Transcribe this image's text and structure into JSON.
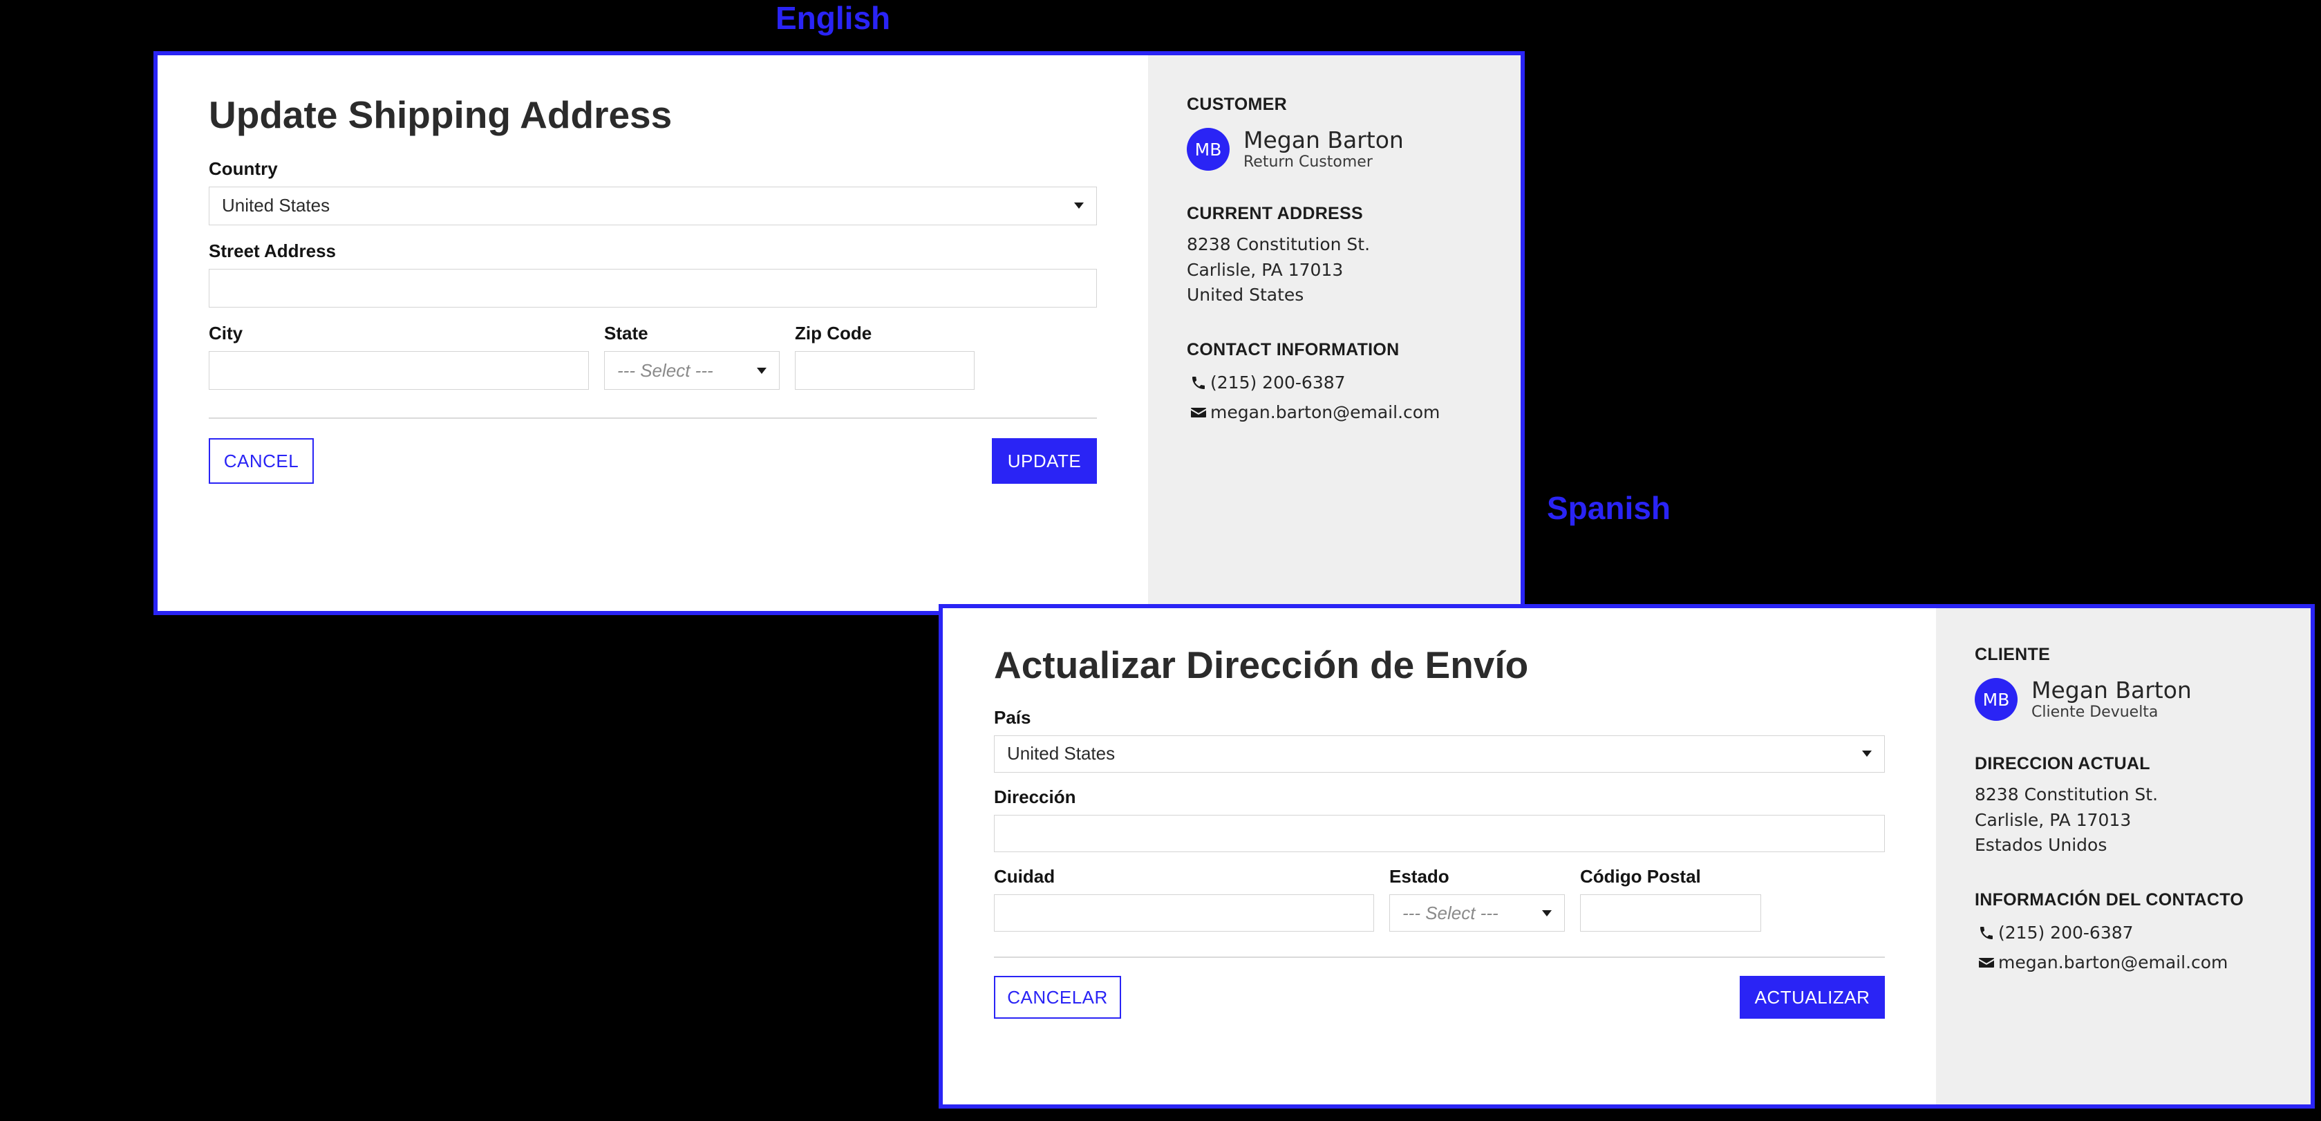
{
  "theme": {
    "accent": "#2a24f5",
    "panel_bg": "#ffffff",
    "aside_bg": "#efefef",
    "backdrop": "#000000",
    "input_border": "#d4d4d4",
    "divider": "#dadada",
    "text": "#262626"
  },
  "annotations": [
    {
      "name": "english-label",
      "text": "English"
    },
    {
      "name": "spanish-label",
      "text": "Spanish"
    }
  ],
  "english": {
    "form": {
      "title": "Update Shipping Address",
      "country": {
        "label": "Country",
        "value": "United States"
      },
      "street": {
        "label": "Street Address",
        "value": "",
        "placeholder": ""
      },
      "city": {
        "label": "City",
        "value": "",
        "placeholder": ""
      },
      "state": {
        "label": "State",
        "value": "--- Select ---"
      },
      "zip": {
        "label": "Zip Code",
        "value": "",
        "placeholder": ""
      },
      "cancel_label": "CANCEL",
      "update_label": "UPDATE"
    },
    "aside": {
      "customer_heading": "CUSTOMER",
      "avatar_initials": "MB",
      "customer_name": "Megan Barton",
      "customer_type": "Return Customer",
      "address_heading": "CURRENT ADDRESS",
      "address_lines": [
        "8238 Constitution St.",
        "Carlisle, PA 17013",
        "United States"
      ],
      "contact_heading": "CONTACT INFORMATION",
      "phone": "(215) 200-6387",
      "email": "megan.barton@email.com",
      "phone_icon": "phone-icon",
      "email_icon": "envelope-icon"
    }
  },
  "spanish": {
    "form": {
      "title": "Actualizar Dirección de Envío",
      "country": {
        "label": "País",
        "value": "United States"
      },
      "street": {
        "label": "Dirección",
        "value": "",
        "placeholder": ""
      },
      "city": {
        "label": "Cuidad",
        "value": "",
        "placeholder": ""
      },
      "state": {
        "label": "Estado",
        "value": "--- Select ---"
      },
      "zip": {
        "label": "Código Postal",
        "value": "",
        "placeholder": ""
      },
      "cancel_label": "CANCELAR",
      "update_label": "ACTUALIZAR"
    },
    "aside": {
      "customer_heading": "CLIENTE",
      "avatar_initials": "MB",
      "customer_name": "Megan Barton",
      "customer_type": "Cliente Devuelta",
      "address_heading": "DIRECCION ACTUAL",
      "address_lines": [
        "8238 Constitution St.",
        "Carlisle, PA 17013",
        "Estados Unidos"
      ],
      "contact_heading": "INFORMACIÓN DEL CONTACTO",
      "phone": "(215) 200-6387",
      "email": "megan.barton@email.com",
      "phone_icon": "phone-icon",
      "email_icon": "envelope-icon"
    }
  }
}
